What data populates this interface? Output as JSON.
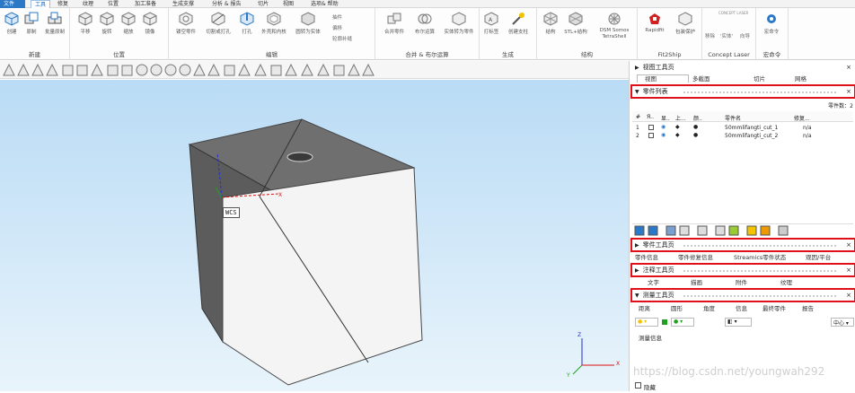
{
  "menu": {
    "tabs": [
      "文件",
      "工具",
      "修复",
      "纹理",
      "位置",
      "加工准备",
      "生成支撑",
      "分析 & 报告",
      "切片",
      "视图",
      "选项& 帮助"
    ],
    "active": "工具"
  },
  "ribbon": {
    "groups": [
      {
        "title": "新建",
        "buttons": [
          "创建",
          "原制",
          "批量原制"
        ]
      },
      {
        "title": "位置",
        "buttons": [
          "平移",
          "旋转",
          "缩放",
          "镜像"
        ]
      },
      {
        "title": "编辑",
        "buttons": [
          "镂空零件",
          "切割或打孔",
          "打孔",
          "外壳和内核",
          "圆转为实体"
        ],
        "small": [
          "抽件",
          "偏移",
          "轮廓补缝"
        ]
      },
      {
        "title": "合并 & 布尔运算",
        "buttons": [
          "合并零件",
          "布尔运算",
          "实体转为零件"
        ]
      },
      {
        "title": "生成",
        "buttons": [
          "打标签",
          "创建支柱"
        ]
      },
      {
        "title": "结构",
        "buttons": [
          "结构",
          "STL+结构",
          "DSM Somos TetraShell"
        ]
      },
      {
        "title": "Fit2Ship",
        "buttons": [
          "Rapidfit",
          "包装保护"
        ]
      },
      {
        "title": "Concept Laser",
        "buttons": [
          "移除",
          "'实体'",
          "向导"
        ],
        "tag": "CONCEPT LASER"
      },
      {
        "title": "宏命令",
        "buttons": [
          "宏命令"
        ]
      }
    ]
  },
  "panel": {
    "view_tools": {
      "title": "视图工具页",
      "tabs": [
        "视图",
        "多截面",
        "切片",
        "网格"
      ]
    },
    "parts_list": {
      "title": "零件列表",
      "count_label": "零件数：2",
      "columns": [
        "#",
        "Я..",
        "显..",
        "上...",
        "颜..",
        "零件名",
        "修复..."
      ],
      "rows": [
        {
          "index": "1",
          "name": "50mmlifangti_cut_1",
          "repair": "n/a"
        },
        {
          "index": "2",
          "name": "50mmlifangti_cut_2",
          "repair": "n/a"
        }
      ]
    },
    "part_tools": {
      "title": "零件工具页",
      "tabs": [
        "零件信息",
        "零件修复信息",
        "Streamics零件状态",
        "观因/平台"
      ]
    },
    "annotation_tools": {
      "title": "注释工具页",
      "tabs": [
        "文字",
        "描画",
        "附件",
        "纹理"
      ]
    },
    "measure_tools": {
      "title": "测量工具页",
      "tabs": [
        "距离",
        "圆形",
        "角度",
        "信息",
        "最终零件",
        "报告"
      ],
      "center_label": "中心",
      "info_label": "测量信息",
      "hide_label": "隐藏"
    }
  },
  "viewport": {
    "wcs_label": "WCS",
    "axes": {
      "x": "X",
      "y": "Y",
      "z": "Z"
    }
  },
  "watermark": "https://blog.csdn.net/youngwah292",
  "colors": {
    "highlight": "#e0101a",
    "accent": "#2b79c6",
    "viewport_top": "#b9dbf5"
  }
}
